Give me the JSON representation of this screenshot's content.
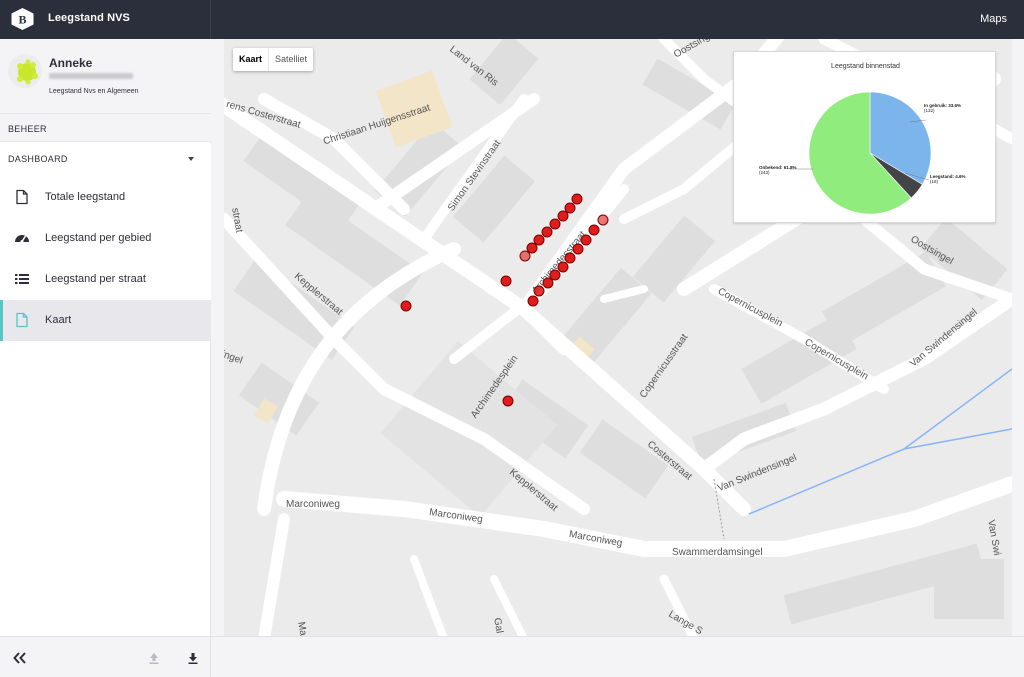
{
  "app": {
    "title": "Leegstand NVS",
    "logo_letter": "B",
    "page": "Maps"
  },
  "user": {
    "name": "Anneke",
    "org": "Leegstand Nvs en Algemeen"
  },
  "sidebar": {
    "section_beheer": "BEHEER",
    "section_dashboard": "DASHBOARD",
    "items": [
      {
        "label": "Totale leegstand",
        "icon": "document-icon"
      },
      {
        "label": "Leegstand per gebied",
        "icon": "gauge-icon"
      },
      {
        "label": "Leegstand per straat",
        "icon": "list-icon"
      },
      {
        "label": "Kaart",
        "icon": "document-icon",
        "active": true
      }
    ],
    "accent_color": "#56c4c9"
  },
  "map": {
    "type_buttons": [
      "Kaart",
      "Satelliet"
    ],
    "selected_type": "Kaart",
    "streets": [
      "Land van Ris",
      "Oostsingel",
      "Christiaan Huijgensstraat",
      "Simon Stevinstraat",
      "Archimedesstraat",
      "Copernicusplein",
      "Copernicusstraat",
      "Archimedesplein",
      "Kepplerstraat",
      "Laurens Costerstraat",
      "Van Swindensingel",
      "Marconiweg",
      "Swammerdamsingel",
      "Lange S",
      "Gal",
      "Ma",
      "Van Swi",
      "Costerstraat",
      "rens Costerstraat",
      "straat",
      "ingel"
    ],
    "marker_color": "#e01d1d"
  },
  "chart_data": {
    "type": "pie",
    "title": "Leegstand binnenstad",
    "slices": [
      {
        "label": "In gebruik",
        "percent": 33.6,
        "count": 132,
        "color": "#7cb5ec"
      },
      {
        "label": "Leegstand",
        "percent": 4.6,
        "count": 18,
        "color": "#434348"
      },
      {
        "label": "Onbekend",
        "percent": 61.8,
        "count": 243,
        "color": "#90ed7d"
      }
    ],
    "labels": [
      "In gebruik: 33.6%",
      "(132)",
      "Leegstand: 4.6%",
      "(18)",
      "Onbekend: 61.8%",
      "(243)"
    ]
  }
}
